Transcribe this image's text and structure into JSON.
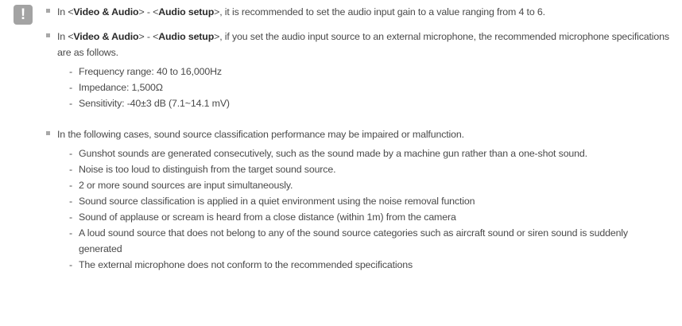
{
  "note": {
    "icon_glyph": "!",
    "icon": "exclamation-icon",
    "icon_color": "#a3a3a3"
  },
  "items": [
    {
      "pre": "In <",
      "menu1": "Video & Audio",
      "mid": "> - <",
      "menu2": "Audio setup",
      "post": ">, it is recommended to set the audio input gain to a value ranging from 4 to 6."
    },
    {
      "pre": "In <",
      "menu1": "Video & Audio",
      "mid": "> - <",
      "menu2": "Audio setup",
      "post": ">, if you set the audio input source to an external microphone, the recommended microphone specifications are as follows.",
      "subs": [
        "Frequency range: 40 to 16,000Hz",
        "Impedance: 1,500Ω",
        "Sensitivity: -40±3 dB (7.1~14.1 mV)"
      ]
    },
    {
      "text": "In the following cases, sound source classification performance may be impaired or malfunction.",
      "subs": [
        "Gunshot sounds are generated consecutively, such as the sound made by a machine gun rather than a one-shot sound.",
        "Noise is too loud to distinguish from the target sound source.",
        "2 or more sound sources are input simultaneously.",
        "Sound source classification is applied in a quiet environment using the noise removal function",
        "Sound of applause or scream is heard from a close distance (within 1m) from the camera",
        "A loud sound source that does not belong to any of the sound source categories such as aircraft sound or siren sound is suddenly generated",
        "The external microphone does not conform to the recommended specifications"
      ]
    }
  ]
}
